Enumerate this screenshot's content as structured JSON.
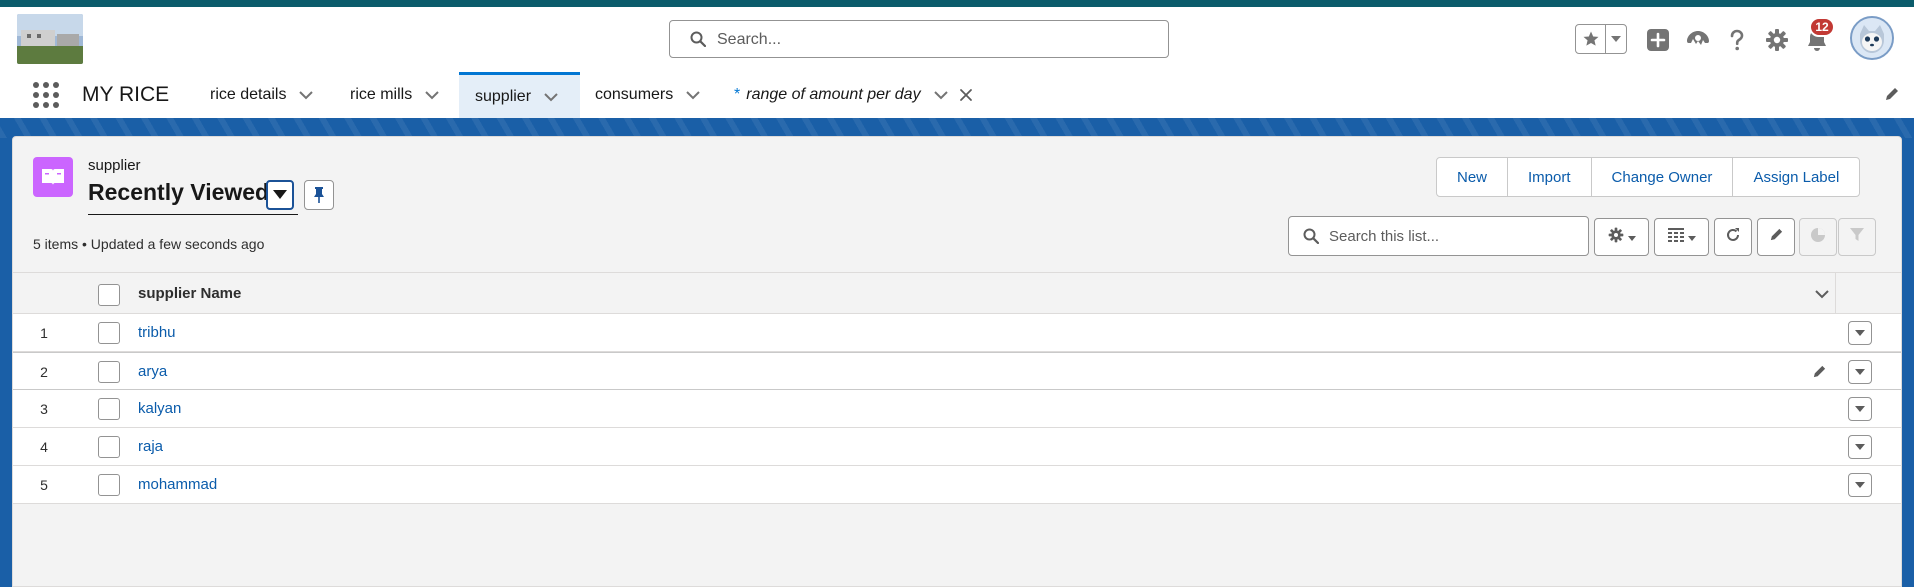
{
  "header": {
    "search_placeholder": "Search...",
    "notification_count": "12",
    "icons": [
      "favorites-star-icon",
      "favorites-dropdown-icon",
      "global-actions-add-icon",
      "trailhead-icon",
      "help-icon",
      "setup-gear-icon",
      "notifications-bell-icon",
      "user-avatar"
    ]
  },
  "nav": {
    "app_name": "MY RICE",
    "tabs": [
      {
        "label": "rice details"
      },
      {
        "label": "rice mills"
      },
      {
        "label": "supplier",
        "active": true
      },
      {
        "label": "consumers"
      },
      {
        "label": "range of amount per day",
        "temporary": true,
        "prefix": "*"
      }
    ]
  },
  "list_view": {
    "object_name": "supplier",
    "title": "Recently Viewed",
    "meta": "5 items • Updated a few seconds ago",
    "buttons": [
      "New",
      "Import",
      "Change Owner",
      "Assign Label"
    ],
    "search_placeholder": "Search this list...",
    "column_header": "supplier Name",
    "rows": [
      {
        "num": "1",
        "name": "tribhu"
      },
      {
        "num": "2",
        "name": "arya"
      },
      {
        "num": "3",
        "name": "kalyan"
      },
      {
        "num": "4",
        "name": "raja"
      },
      {
        "num": "5",
        "name": "mohammad"
      }
    ]
  },
  "colors": {
    "brand_bar": "#0b5c6b",
    "accent_blue": "#0176d3",
    "link_blue": "#0b5cab",
    "object_icon": "#cb65ff",
    "badge_red": "#c23934"
  }
}
